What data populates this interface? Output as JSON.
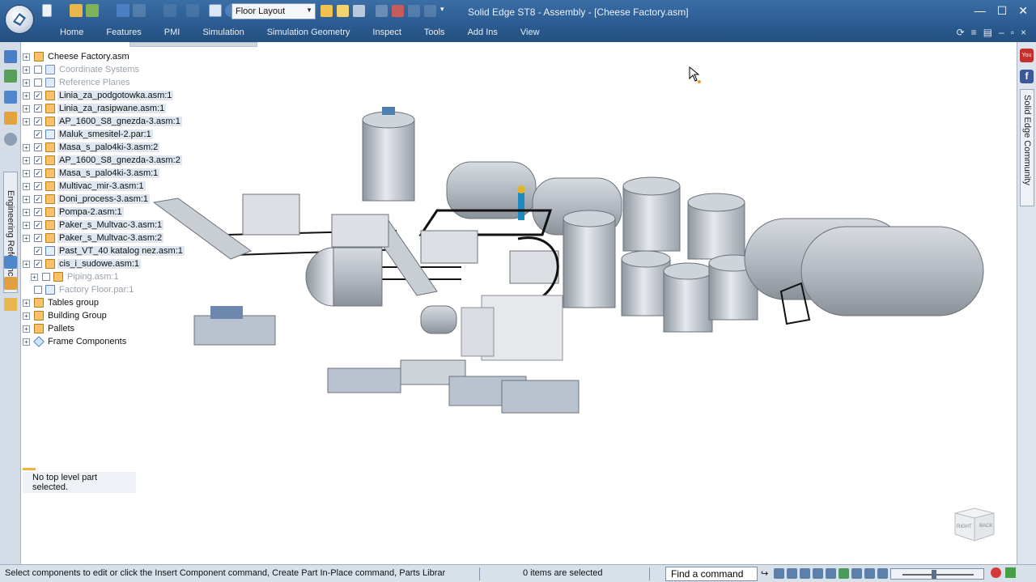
{
  "window": {
    "title": "Solid Edge ST8 - Assembly - [Cheese Factory.asm]",
    "layout_value": "Floor Layout"
  },
  "ribbon": {
    "tabs": [
      "Home",
      "Features",
      "PMI",
      "Simulation",
      "Simulation Geometry",
      "Inspect",
      "Tools",
      "Add Ins",
      "View"
    ]
  },
  "left_panel": {
    "vertical_tab": "Engineering Reference"
  },
  "right_panel": {
    "youtube": "You",
    "facebook": "f",
    "vertical_tab": "Solid Edge Community"
  },
  "tree": {
    "root": "Cheese Factory.asm",
    "items": [
      {
        "label": "Coordinate Systems",
        "checked": false,
        "expand": true,
        "icon": "coord",
        "dim": true
      },
      {
        "label": "Reference Planes",
        "checked": false,
        "expand": true,
        "icon": "coord",
        "dim": true
      },
      {
        "label": "Linia_za_podgotowka.asm:1",
        "checked": true,
        "expand": true,
        "icon": "asm"
      },
      {
        "label": "Linia_za_rasipwane.asm:1",
        "checked": true,
        "expand": true,
        "icon": "asm"
      },
      {
        "label": "AP_1600_S8_gnezda-3.asm:1",
        "checked": true,
        "expand": true,
        "icon": "asm"
      },
      {
        "label": "Maluk_smesitel-2.par:1",
        "checked": true,
        "expand": false,
        "icon": "part"
      },
      {
        "label": "Masa_s_palo4ki-3.asm:2",
        "checked": true,
        "expand": true,
        "icon": "asm"
      },
      {
        "label": "AP_1600_S8_gnezda-3.asm:2",
        "checked": true,
        "expand": true,
        "icon": "asm"
      },
      {
        "label": "Masa_s_palo4ki-3.asm:1",
        "checked": true,
        "expand": true,
        "icon": "asm"
      },
      {
        "label": "Multivac_mir-3.asm:1",
        "checked": true,
        "expand": true,
        "icon": "asm"
      },
      {
        "label": "Doni_process-3.asm:1",
        "checked": true,
        "expand": true,
        "icon": "asm"
      },
      {
        "label": "Pompa-2.asm:1",
        "checked": true,
        "expand": true,
        "icon": "asm"
      },
      {
        "label": "Paker_s_Multvac-3.asm:1",
        "checked": true,
        "expand": true,
        "icon": "asm"
      },
      {
        "label": "Paker_s_Multvac-3.asm:2",
        "checked": true,
        "expand": true,
        "icon": "asm"
      },
      {
        "label": "Past_VT_40 katalog nez.asm:1",
        "checked": true,
        "expand": false,
        "icon": "part"
      },
      {
        "label": "cis_i_sudowe.asm:1",
        "checked": true,
        "expand": true,
        "icon": "asm"
      },
      {
        "label": "Piping.asm:1",
        "checked": false,
        "expand": true,
        "icon": "asm",
        "dim": true,
        "indent": true
      },
      {
        "label": "Factory Floor.par:1",
        "checked": false,
        "expand": false,
        "icon": "part",
        "dim": true
      }
    ],
    "groups": [
      {
        "label": "Tables group",
        "icon": "asm"
      },
      {
        "label": "Building Group",
        "icon": "asm"
      },
      {
        "label": "Pallets",
        "icon": "asm"
      },
      {
        "label": "Frame Components",
        "icon": "frame"
      }
    ],
    "selection_status": "No top level part selected."
  },
  "viewcube": {
    "right": "RIGHT",
    "back": "BACK"
  },
  "status_bar": {
    "prompt": "Select components to edit or click the Insert Component command, Create Part In-Place command, Parts Librar",
    "items_selected": "0 items are selected",
    "find_command": "Find a command"
  }
}
